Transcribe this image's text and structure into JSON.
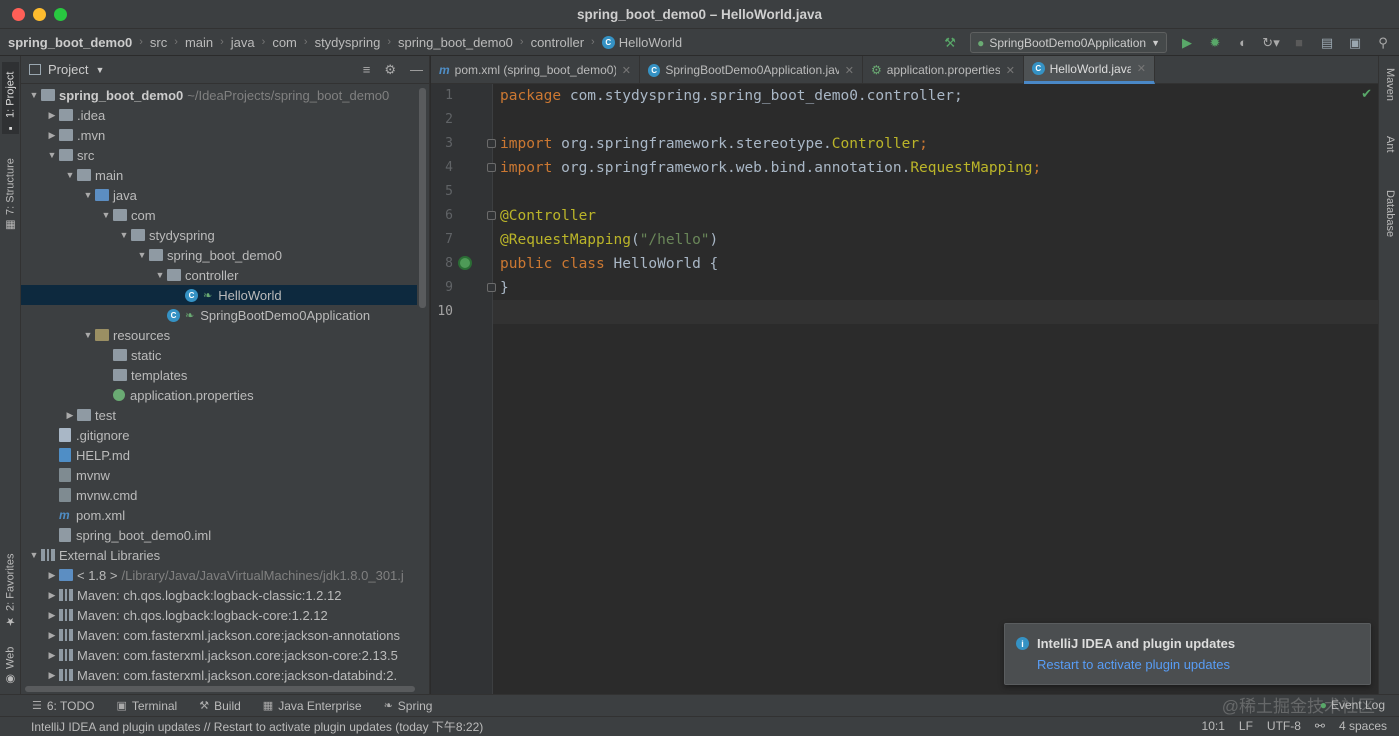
{
  "window": {
    "title": "spring_boot_demo0 – HelloWorld.java"
  },
  "breadcrumbs": [
    "spring_boot_demo0",
    "src",
    "main",
    "java",
    "com",
    "stydyspring",
    "spring_boot_demo0",
    "controller",
    "HelloWorld"
  ],
  "run_config": {
    "label": "SpringBootDemo0Application"
  },
  "left_tool_tabs": [
    {
      "label": "1: Project",
      "icon": "project-icon"
    },
    {
      "label": "7: Structure",
      "icon": "structure-icon"
    },
    {
      "label": "2: Favorites",
      "icon": "star-icon"
    },
    {
      "label": "Web",
      "icon": "web-icon"
    }
  ],
  "right_tool_tabs": [
    "Maven",
    "Ant",
    "Database"
  ],
  "project_panel": {
    "title": "Project",
    "tree": [
      {
        "label": "spring_boot_demo0",
        "suffix": "~/IdeaProjects/spring_boot_demo0",
        "depth": 0,
        "arrow": "down",
        "icon": "module-folder"
      },
      {
        "label": ".idea",
        "depth": 1,
        "arrow": "right",
        "icon": "folder"
      },
      {
        "label": ".mvn",
        "depth": 1,
        "arrow": "right",
        "icon": "folder"
      },
      {
        "label": "src",
        "depth": 1,
        "arrow": "down",
        "icon": "folder"
      },
      {
        "label": "main",
        "depth": 2,
        "arrow": "down",
        "icon": "folder"
      },
      {
        "label": "java",
        "depth": 3,
        "arrow": "down",
        "icon": "source-folder"
      },
      {
        "label": "com",
        "depth": 4,
        "arrow": "down",
        "icon": "package"
      },
      {
        "label": "stydyspring",
        "depth": 5,
        "arrow": "down",
        "icon": "package"
      },
      {
        "label": "spring_boot_demo0",
        "depth": 6,
        "arrow": "down",
        "icon": "package"
      },
      {
        "label": "controller",
        "depth": 7,
        "arrow": "down",
        "icon": "package"
      },
      {
        "label": "HelloWorld",
        "depth": 8,
        "arrow": "none",
        "icon": "spring-class",
        "selected": true
      },
      {
        "label": "SpringBootDemo0Application",
        "depth": 7,
        "arrow": "none",
        "icon": "spring-boot-class"
      },
      {
        "label": "resources",
        "depth": 3,
        "arrow": "down",
        "icon": "resources-folder"
      },
      {
        "label": "static",
        "depth": 4,
        "arrow": "none",
        "icon": "folder"
      },
      {
        "label": "templates",
        "depth": 4,
        "arrow": "none",
        "icon": "folder"
      },
      {
        "label": "application.properties",
        "depth": 4,
        "arrow": "none",
        "icon": "properties-file"
      },
      {
        "label": "test",
        "depth": 2,
        "arrow": "right",
        "icon": "folder"
      },
      {
        "label": ".gitignore",
        "depth": 1,
        "arrow": "none",
        "icon": "text-file"
      },
      {
        "label": "HELP.md",
        "depth": 1,
        "arrow": "none",
        "icon": "markdown-file"
      },
      {
        "label": "mvnw",
        "depth": 1,
        "arrow": "none",
        "icon": "script-file"
      },
      {
        "label": "mvnw.cmd",
        "depth": 1,
        "arrow": "none",
        "icon": "script-file"
      },
      {
        "label": "pom.xml",
        "depth": 1,
        "arrow": "none",
        "icon": "maven-file"
      },
      {
        "label": "spring_boot_demo0.iml",
        "depth": 1,
        "arrow": "none",
        "icon": "iml-file"
      },
      {
        "label": "External Libraries",
        "depth": 0,
        "arrow": "down",
        "icon": "library"
      },
      {
        "label": "< 1.8 >",
        "suffix": "/Library/Java/JavaVirtualMachines/jdk1.8.0_301.j",
        "depth": 1,
        "arrow": "right",
        "icon": "sdk"
      },
      {
        "label": "Maven: ch.qos.logback:logback-classic:1.2.12",
        "depth": 1,
        "arrow": "right",
        "icon": "library"
      },
      {
        "label": "Maven: ch.qos.logback:logback-core:1.2.12",
        "depth": 1,
        "arrow": "right",
        "icon": "library"
      },
      {
        "label": "Maven: com.fasterxml.jackson.core:jackson-annotations",
        "depth": 1,
        "arrow": "right",
        "icon": "library"
      },
      {
        "label": "Maven: com.fasterxml.jackson.core:jackson-core:2.13.5",
        "depth": 1,
        "arrow": "right",
        "icon": "library"
      },
      {
        "label": "Maven: com.fasterxml.jackson.core:jackson-databind:2.",
        "depth": 1,
        "arrow": "right",
        "icon": "library"
      }
    ]
  },
  "editor_tabs": [
    {
      "label": "pom.xml (spring_boot_demo0)",
      "icon": "maven-icon",
      "active": false
    },
    {
      "label": "SpringBootDemo0Application.java",
      "icon": "spring-boot-class-icon",
      "active": false
    },
    {
      "label": "application.properties",
      "icon": "properties-icon",
      "active": false
    },
    {
      "label": "HelloWorld.java",
      "icon": "class-icon",
      "active": true
    }
  ],
  "editor": {
    "line_numbers": [
      "1",
      "2",
      "3",
      "4",
      "5",
      "6",
      "7",
      "8",
      "9",
      "10"
    ],
    "current_line": "10",
    "lines": [
      [
        {
          "t": "package",
          "c": "kw"
        },
        {
          "t": " com.stydyspring.spring_boot_demo0.controller;",
          "c": ""
        }
      ],
      [],
      [
        {
          "t": "import",
          "c": "kw"
        },
        {
          "t": " org.springframework.stereotype.",
          "c": ""
        },
        {
          "t": "Controller",
          "c": "ann"
        },
        {
          "t": ";",
          "c": "kw"
        }
      ],
      [
        {
          "t": "import",
          "c": "kw"
        },
        {
          "t": " org.springframework.web.bind.annotation.",
          "c": ""
        },
        {
          "t": "RequestMapping",
          "c": "ann"
        },
        {
          "t": ";",
          "c": "kw"
        }
      ],
      [],
      [
        {
          "t": "@Controller",
          "c": "ann"
        }
      ],
      [
        {
          "t": "@RequestMapping",
          "c": "ann"
        },
        {
          "t": "(",
          "c": ""
        },
        {
          "t": "\"/hello\"",
          "c": "str"
        },
        {
          "t": ")",
          "c": ""
        }
      ],
      [
        {
          "t": "public class",
          "c": "kw"
        },
        {
          "t": " HelloWorld {",
          "c": ""
        }
      ],
      [
        {
          "t": "}",
          "c": ""
        }
      ],
      []
    ]
  },
  "notification": {
    "title": "IntelliJ IDEA and plugin updates",
    "link": "Restart to activate plugin updates"
  },
  "tool_windows": [
    {
      "label": "6: TODO",
      "icon": "todo-icon"
    },
    {
      "label": "Terminal",
      "icon": "terminal-icon"
    },
    {
      "label": "Build",
      "icon": "build-icon"
    },
    {
      "label": "Java Enterprise",
      "icon": "java-enterprise-icon"
    },
    {
      "label": "Spring",
      "icon": "spring-icon"
    }
  ],
  "event_log": "Event Log",
  "watermark": "@稀土掘金技术社区",
  "status": {
    "message": "IntelliJ IDEA and plugin updates // Restart to activate plugin updates (today 下午8:22)",
    "position": "10:1",
    "line_sep": "LF",
    "encoding": "UTF-8",
    "indent": "4 spaces"
  }
}
